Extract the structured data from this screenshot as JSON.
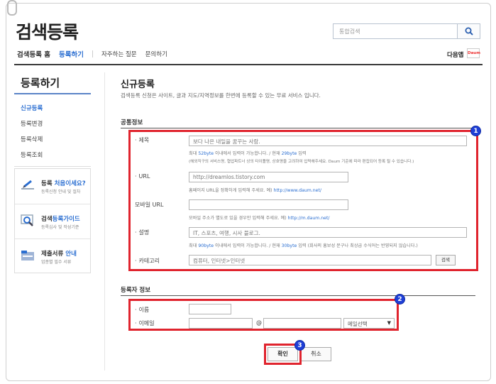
{
  "logo": "검색등록",
  "search": {
    "placeholder": "통합검색"
  },
  "topnav": {
    "home": "검색등록 홈",
    "register": "등록하기",
    "faq": "자주하는 질문",
    "contact": "문의하기"
  },
  "daum": {
    "label": "다음앱",
    "badge": "Daum"
  },
  "sidebar": {
    "title": "등록하기",
    "items": [
      {
        "label": "신규등록"
      },
      {
        "label": "등록변경"
      },
      {
        "label": "등록삭제"
      },
      {
        "label": "등록조회"
      }
    ],
    "promos": [
      {
        "title_pre": "등록 ",
        "title_hl": "처음이세요?",
        "sub": "등록신청 안내 및 절차"
      },
      {
        "title_pre": "검색",
        "title_hl": "등록가이드",
        "sub": "등록심사 및 작성기준"
      },
      {
        "title_pre": "제출서류 ",
        "title_hl": "안내",
        "sub": "업종별 필수 서류"
      }
    ]
  },
  "main": {
    "title": "신규등록",
    "desc": "검색등록 신청은 사이트, 글과 지도/지역정보를 한번에 등록할 수 있는 무료 서비스 입니다.",
    "common_section": "공통정보",
    "registrant_section": "등록자 정보"
  },
  "form": {
    "title_label": "제목",
    "title_value": "보다 나은 내일을 꿈꾸는 사람.",
    "title_hint1_pre": "최대 ",
    "title_hint1_max": "52byte",
    "title_hint1_mid": " 이내에서 입력이 가능합니다. / 현재 ",
    "title_hint1_cur": "29byte",
    "title_hint1_post": " 입력",
    "title_hint2": "(해외직구의 서비스명, 협업파트너 상의 타이틀명, 상호명을 고려하여 입력해주세요. Daum 기준에 따라 편집되어 등록 될 수 있습니다.)",
    "url_label": "URL",
    "url_value": "http://dreamlos.tistory.com",
    "url_hint_pre": "홈페이지 URL을 정확하게 입력해 주세요. 예) ",
    "url_hint_link": "http://www.daum.net/",
    "mobile_label": "모바일 URL",
    "mobile_value": "",
    "mobile_hint_pre": "모바일 주소가 별도로 있을 경우만 입력해 주세요. 예) ",
    "mobile_hint_link": "http://m.daum.net/",
    "desc_label": "설명",
    "desc_value": "IT, 스포츠, 여행, 시사 블로그.",
    "desc_hint_pre": "최대 ",
    "desc_hint_max": "90byte",
    "desc_hint_mid": " 이내에서 입력이 가능합니다. / 현재 ",
    "desc_hint_cur": "30byte",
    "desc_hint_post": " 입력 (회사의 홍보성 문구나 최상급 수식어는 반영되지 않습니다.)",
    "category_label": "카테고리",
    "category_value": "컴퓨터, 인터넷>인터넷",
    "category_search": "검색",
    "name_label": "이름",
    "name_value": "",
    "email_label": "이메일",
    "email_at": "@",
    "email_select": "메일선택",
    "confirm": "확인",
    "cancel": "취소"
  },
  "annotations": {
    "b1": "1",
    "b2": "2",
    "b3": "3"
  },
  "colors": {
    "accent": "#2a6ed1",
    "highlight_box": "#e0242e",
    "badge": "#1f3fd6"
  }
}
